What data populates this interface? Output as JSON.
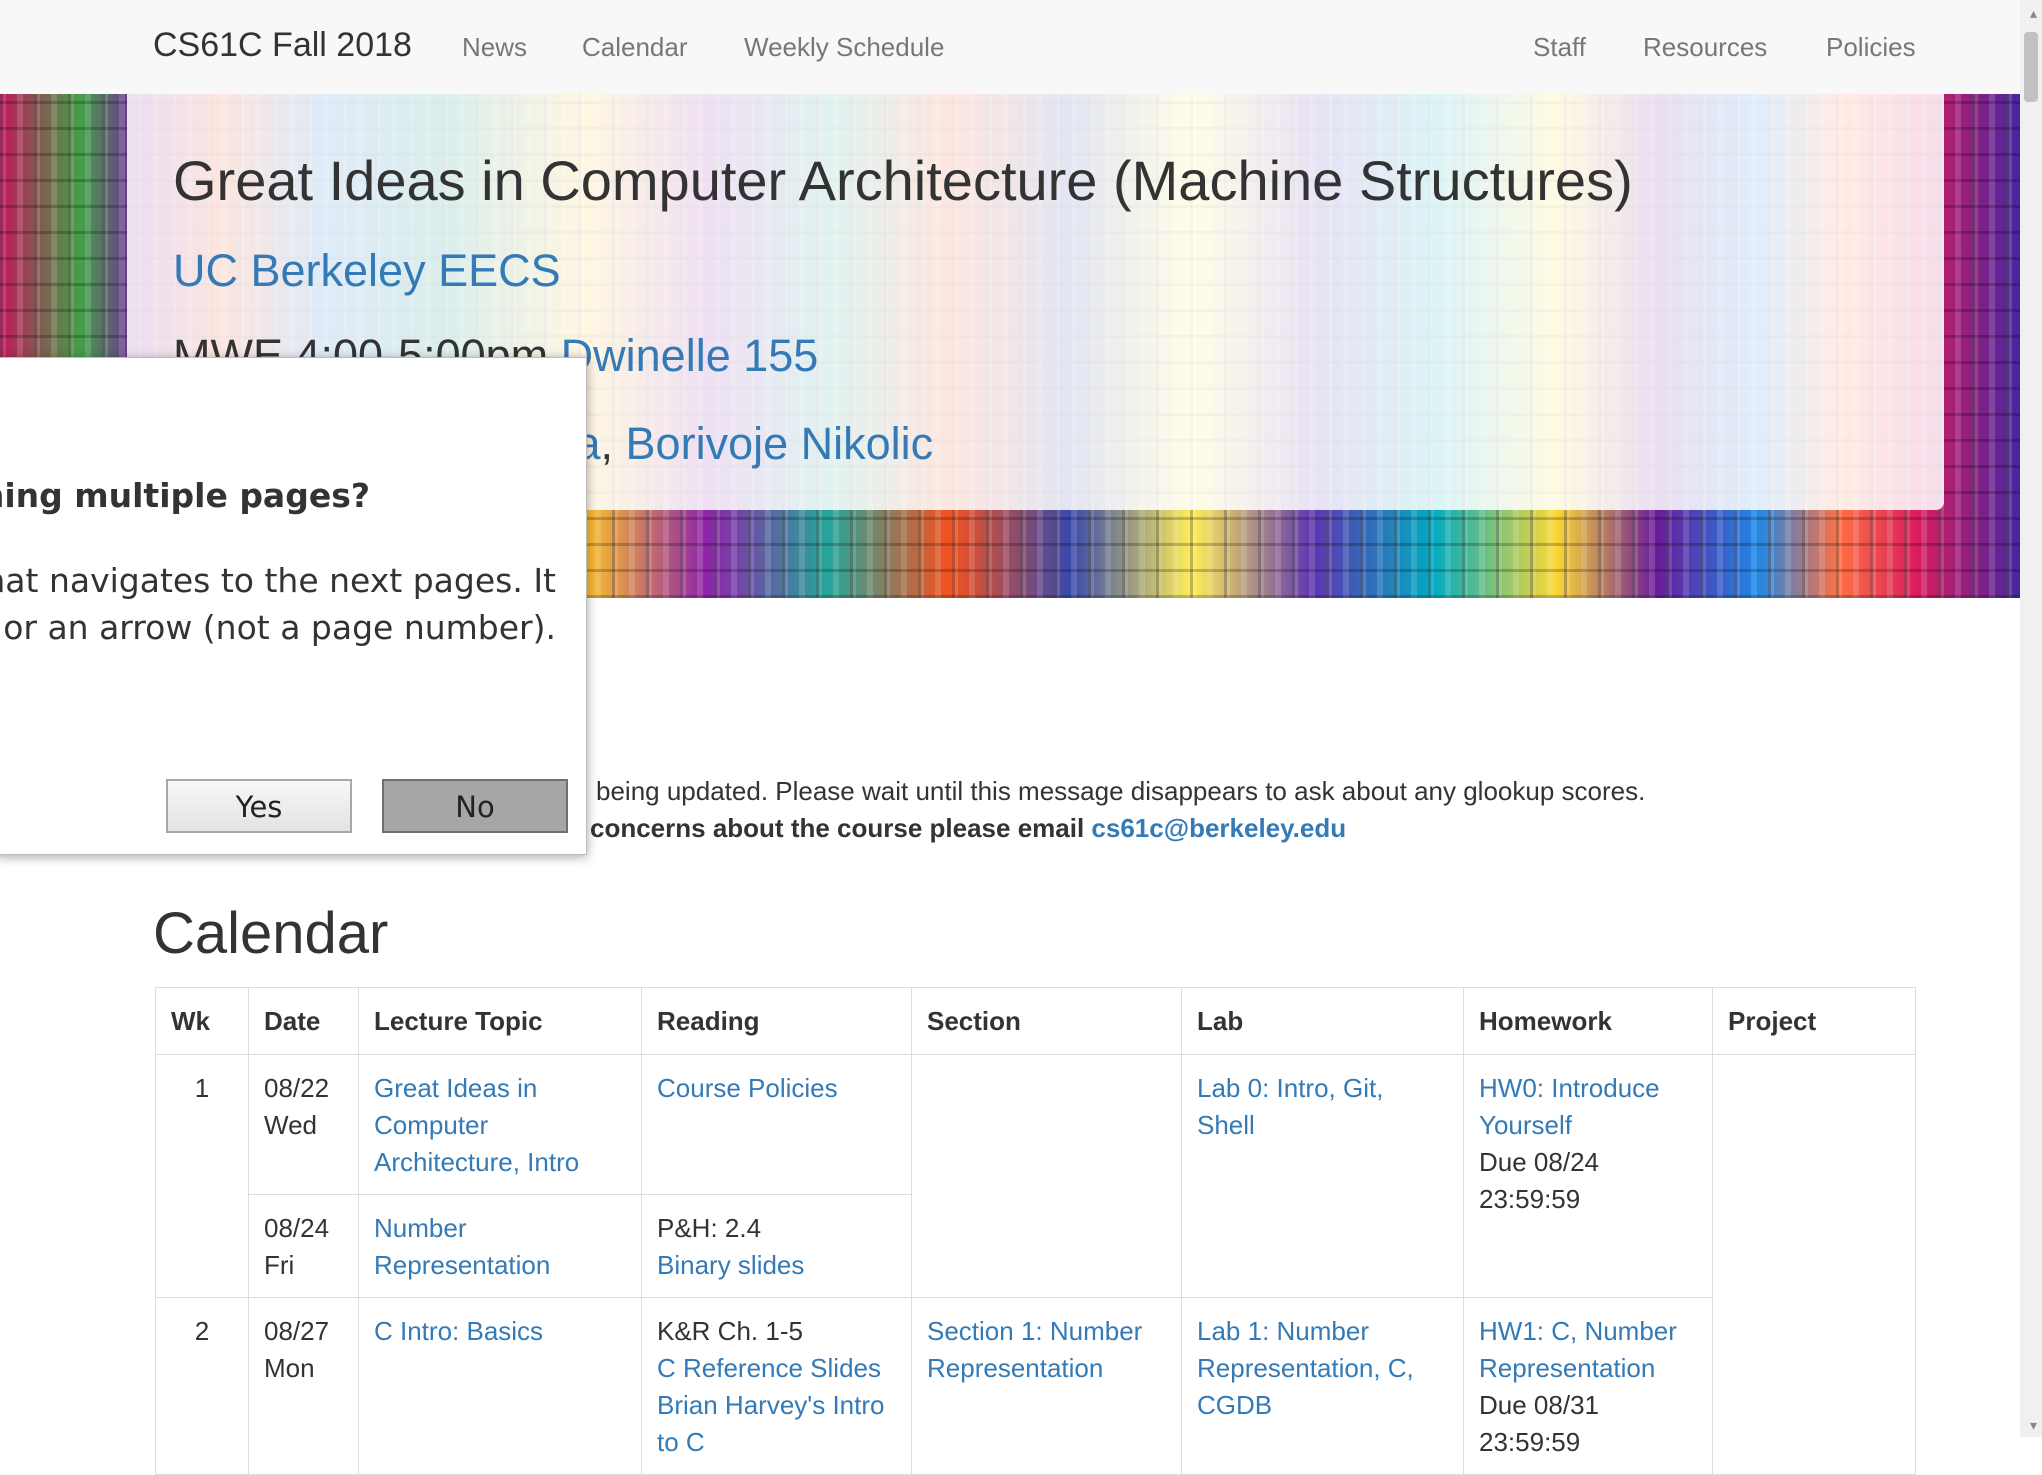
{
  "navbar": {
    "brand": "CS61C Fall 2018",
    "left_items": [
      "News",
      "Calendar",
      "Weekly Schedule"
    ],
    "right_items": [
      "Staff",
      "Resources",
      "Policies"
    ]
  },
  "header": {
    "title": "Great Ideas in Computer Architecture (Machine Structures)",
    "subtitle": "UC Berkeley EECS",
    "meta_visible": "MWE 4:00-5:00pm",
    "location": "Dwinelle 155",
    "instructor_partial": "cia",
    "instructor_sep": ", ",
    "instructor2": "Borivoje Nikolic"
  },
  "announcements": {
    "line1": "being updated. Please wait until this message disappears to ask about any glookup scores.",
    "line2_prefix": "concerns about the course please email",
    "email": "cs61c@berkeley.edu"
  },
  "calendar": {
    "heading": "Calendar",
    "columns": [
      "Wk",
      "Date",
      "Lecture Topic",
      "Reading",
      "Section",
      "Lab",
      "Homework",
      "Project"
    ],
    "w1": {
      "wk": "1",
      "d1_date": "08/22",
      "d1_day": "Wed",
      "d1_lecture": [
        "Great Ideas in",
        "Computer",
        "Architecture, Intro"
      ],
      "d1_reading": "Course Policies",
      "lab": [
        "Lab 0: Intro, Git,",
        "Shell"
      ],
      "hw": [
        "HW0: Introduce",
        "Yourself"
      ],
      "hw_due": [
        "Due 08/24",
        "23:59:59"
      ],
      "d2_date": "08/24",
      "d2_day": "Fri",
      "d2_lecture": [
        "Number",
        "Representation"
      ],
      "d2_reading_text": "P&H: 2.4",
      "d2_reading_link": "Binary slides"
    },
    "w2": {
      "wk": "2",
      "date": "08/27",
      "day": "Mon",
      "lecture": "C Intro: Basics",
      "reading_text": "K&R Ch. 1-5",
      "reading_links": [
        "C Reference Slides",
        "Brian Harvey's Intro",
        "to C"
      ],
      "section": [
        "Section 1: Number",
        "Representation"
      ],
      "lab": [
        "Lab 1: Number",
        "Representation, C,",
        "CGDB"
      ],
      "hw": [
        "HW1: C, Number",
        "Representation"
      ],
      "hw_due": [
        "Due 08/31",
        "23:59:59"
      ]
    }
  },
  "dialog": {
    "question": "anning multiple pages?",
    "body_line1": "hat navigates to the next pages. It",
    "body_line2": "on or an arrow (not a page number).",
    "yes_label": "Yes",
    "no_label": "No"
  },
  "colors": {
    "link": "#337ab7",
    "text": "#333333",
    "nav_text": "#777777",
    "navbar_bg": "#f8f8f8"
  }
}
